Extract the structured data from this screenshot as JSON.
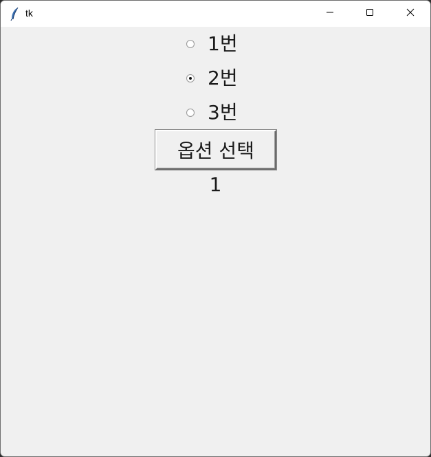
{
  "window": {
    "title": "tk",
    "icon": "feather-icon",
    "controls": [
      "minimize-icon",
      "maximize-icon",
      "close-icon"
    ]
  },
  "radio_options": [
    {
      "label": "1번",
      "checked": false
    },
    {
      "label": "2번",
      "checked": true
    },
    {
      "label": "3번",
      "checked": false
    }
  ],
  "select_button": {
    "label": "옵션 선택"
  },
  "result": {
    "text": "1"
  },
  "colors": {
    "titlebar_bg": "#ffffff",
    "window_bg": "#f0f0f0",
    "text": "#1a1a1a"
  }
}
